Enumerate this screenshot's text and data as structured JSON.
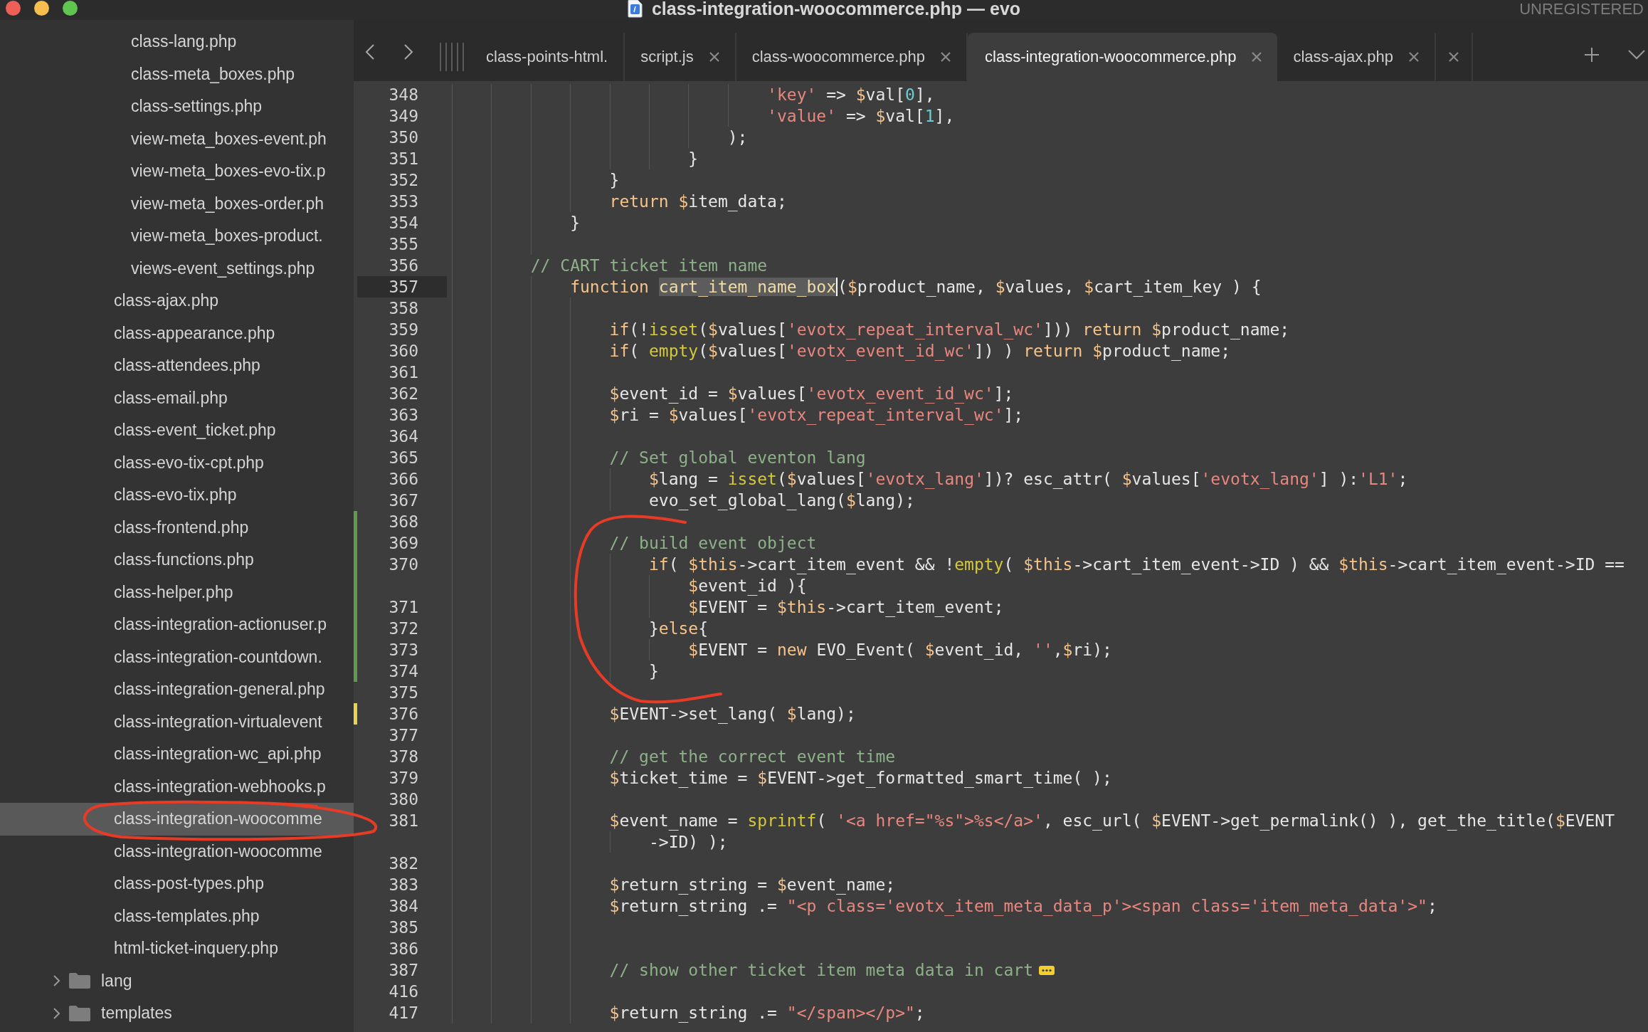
{
  "window": {
    "title": "class-integration-woocommerce.php — evo",
    "status": "UNREGISTERED"
  },
  "sidebar": {
    "items": [
      {
        "kind": "group",
        "children": [
          {
            "kind": "file",
            "label": "class-lang.php",
            "selected": false
          },
          {
            "kind": "file",
            "label": "class-meta_boxes.php",
            "selected": false
          },
          {
            "kind": "file",
            "label": "class-settings.php",
            "selected": false
          },
          {
            "kind": "file",
            "label": "view-meta_boxes-event.ph",
            "selected": false
          },
          {
            "kind": "file",
            "label": "view-meta_boxes-evo-tix.p",
            "selected": false
          },
          {
            "kind": "file",
            "label": "view-meta_boxes-order.ph",
            "selected": false
          },
          {
            "kind": "file",
            "label": "view-meta_boxes-product.",
            "selected": false
          },
          {
            "kind": "file",
            "label": "views-event_settings.php",
            "selected": false
          }
        ]
      },
      {
        "kind": "file",
        "label": "class-ajax.php",
        "selected": false
      },
      {
        "kind": "file",
        "label": "class-appearance.php",
        "selected": false
      },
      {
        "kind": "file",
        "label": "class-attendees.php",
        "selected": false
      },
      {
        "kind": "file",
        "label": "class-email.php",
        "selected": false
      },
      {
        "kind": "file",
        "label": "class-event_ticket.php",
        "selected": false
      },
      {
        "kind": "file",
        "label": "class-evo-tix-cpt.php",
        "selected": false
      },
      {
        "kind": "file",
        "label": "class-evo-tix.php",
        "selected": false
      },
      {
        "kind": "file",
        "label": "class-frontend.php",
        "selected": false
      },
      {
        "kind": "file",
        "label": "class-functions.php",
        "selected": false
      },
      {
        "kind": "file",
        "label": "class-helper.php",
        "selected": false
      },
      {
        "kind": "file",
        "label": "class-integration-actionuser.p",
        "selected": false
      },
      {
        "kind": "file",
        "label": "class-integration-countdown.",
        "selected": false
      },
      {
        "kind": "file",
        "label": "class-integration-general.php",
        "selected": false
      },
      {
        "kind": "file",
        "label": "class-integration-virtualevent",
        "selected": false
      },
      {
        "kind": "file",
        "label": "class-integration-wc_api.php",
        "selected": false
      },
      {
        "kind": "file",
        "label": "class-integration-webhooks.p",
        "selected": false
      },
      {
        "kind": "file",
        "label": "class-integration-woocomme",
        "selected": true
      },
      {
        "kind": "file",
        "label": "class-integration-woocomme",
        "selected": false
      },
      {
        "kind": "file",
        "label": "class-post-types.php",
        "selected": false
      },
      {
        "kind": "file",
        "label": "class-templates.php",
        "selected": false
      },
      {
        "kind": "file",
        "label": "html-ticket-inquery.php",
        "selected": false
      },
      {
        "kind": "folder",
        "label": "lang",
        "expanded": false
      },
      {
        "kind": "folder",
        "label": "templates",
        "expanded": false
      }
    ]
  },
  "tabs": [
    {
      "label": "class-points-html.",
      "selected": false,
      "closable": false
    },
    {
      "label": "script.js",
      "selected": false,
      "closable": true
    },
    {
      "label": "class-woocommerce.php",
      "selected": false,
      "closable": true
    },
    {
      "label": "class-integration-woocommerce.php",
      "selected": true,
      "closable": true
    },
    {
      "label": "class-ajax.php",
      "selected": false,
      "closable": true
    },
    {
      "selected": false,
      "closable": true
    }
  ],
  "editor": {
    "lines": [
      {
        "children": [
          {
            "children": [
              {
                "children": [
                  {
                    "children": [
                      {
                        "children": [
                          {
                            "children": [
                              {
                                "children": [
                                  {
                                    "children": [
                                      {
                                        "no": "348",
                                        "current": false,
                                        "segs": [
                                          {
                                            "kind": "string",
                                            "text": "'key'"
                                          },
                                          {
                                            "kind": "plain",
                                            "text": " => "
                                          },
                                          {
                                            "kind": "var",
                                            "text": "$val"
                                          },
                                          {
                                            "kind": "plain",
                                            "text": "["
                                          },
                                          {
                                            "kind": "number",
                                            "text": "0"
                                          },
                                          {
                                            "kind": "plain",
                                            "text": "],"
                                          }
                                        ]
                                      },
                                      {
                                        "no": "349",
                                        "current": false,
                                        "segs": [
                                          {
                                            "kind": "string",
                                            "text": "'value'"
                                          },
                                          {
                                            "kind": "plain",
                                            "text": " => "
                                          },
                                          {
                                            "kind": "var",
                                            "text": "$val"
                                          },
                                          {
                                            "kind": "plain",
                                            "text": "["
                                          },
                                          {
                                            "kind": "number",
                                            "text": "1"
                                          },
                                          {
                                            "kind": "plain",
                                            "text": "],"
                                          }
                                        ]
                                      }
                                    ]
                                  },
                                  {
                                    "no": "350",
                                    "current": false,
                                    "segs": [
                                      {
                                        "kind": "plain",
                                        "text": ");"
                                      }
                                    ]
                                  }
                                ]
                              },
                              {
                                "no": "351",
                                "current": false,
                                "segs": [
                                  {
                                    "kind": "plain",
                                    "text": "}"
                                  }
                                ]
                              }
                            ]
                          }
                        ]
                      },
                      {
                        "no": "352",
                        "current": false,
                        "segs": [
                          {
                            "kind": "plain",
                            "text": "}"
                          }
                        ]
                      },
                      {
                        "no": "353",
                        "current": false,
                        "segs": [
                          {
                            "kind": "keyword",
                            "text": "return "
                          },
                          {
                            "kind": "var",
                            "text": "$item_data"
                          },
                          {
                            "kind": "plain",
                            "text": ";"
                          }
                        ]
                      }
                    ]
                  },
                  {
                    "no": "354",
                    "current": false,
                    "segs": [
                      {
                        "kind": "plain",
                        "text": "}"
                      }
                    ]
                  },
                  {
                    "no": "355",
                    "current": false
                  }
                ]
              },
              {
                "no": "356",
                "current": false,
                "segs": [
                  {
                    "kind": "comment",
                    "text": "// CART ticket item name"
                  }
                ],
                "children": [
                  {
                    "no": "357",
                    "current": true,
                    "segs": [
                      {
                        "kind": "keyword",
                        "text": "function "
                      },
                      {
                        "kind": "match",
                        "text": "cart_item_name_box"
                      },
                      {
                        "kind": "plain",
                        "text": "("
                      },
                      {
                        "kind": "var",
                        "text": "$product_name"
                      },
                      {
                        "kind": "plain",
                        "text": ", "
                      },
                      {
                        "kind": "var",
                        "text": "$values"
                      },
                      {
                        "kind": "plain",
                        "text": ", "
                      },
                      {
                        "kind": "var",
                        "text": "$cart_item_key"
                      },
                      {
                        "kind": "plain",
                        "text": " ) {"
                      }
                    ],
                    "children": [
                      {
                        "no": "358",
                        "current": false
                      },
                      {
                        "no": "359",
                        "current": false,
                        "segs": [
                          {
                            "kind": "keyword",
                            "text": "if"
                          },
                          {
                            "kind": "plain",
                            "text": "(!"
                          },
                          {
                            "kind": "func",
                            "text": "isset"
                          },
                          {
                            "kind": "plain",
                            "text": "("
                          },
                          {
                            "kind": "var",
                            "text": "$values"
                          },
                          {
                            "kind": "plain",
                            "text": "["
                          },
                          {
                            "kind": "string",
                            "text": "'evotx_repeat_interval_wc'"
                          },
                          {
                            "kind": "plain",
                            "text": "])) "
                          },
                          {
                            "kind": "keyword",
                            "text": "return "
                          },
                          {
                            "kind": "var",
                            "text": "$product_name"
                          },
                          {
                            "kind": "plain",
                            "text": ";"
                          }
                        ]
                      },
                      {
                        "no": "360",
                        "current": false,
                        "segs": [
                          {
                            "kind": "keyword",
                            "text": "if"
                          },
                          {
                            "kind": "plain",
                            "text": "( "
                          },
                          {
                            "kind": "func",
                            "text": "empty"
                          },
                          {
                            "kind": "plain",
                            "text": "("
                          },
                          {
                            "kind": "var",
                            "text": "$values"
                          },
                          {
                            "kind": "plain",
                            "text": "["
                          },
                          {
                            "kind": "string",
                            "text": "'evotx_event_id_wc'"
                          },
                          {
                            "kind": "plain",
                            "text": "]) ) "
                          },
                          {
                            "kind": "keyword",
                            "text": "return "
                          },
                          {
                            "kind": "var",
                            "text": "$product_name"
                          },
                          {
                            "kind": "plain",
                            "text": ";"
                          }
                        ]
                      },
                      {
                        "no": "361",
                        "current": false
                      },
                      {
                        "no": "362",
                        "current": false,
                        "segs": [
                          {
                            "kind": "var",
                            "text": "$event_id"
                          },
                          {
                            "kind": "plain",
                            "text": " = "
                          },
                          {
                            "kind": "var",
                            "text": "$values"
                          },
                          {
                            "kind": "plain",
                            "text": "["
                          },
                          {
                            "kind": "string",
                            "text": "'evotx_event_id_wc'"
                          },
                          {
                            "kind": "plain",
                            "text": "];"
                          }
                        ]
                      },
                      {
                        "no": "363",
                        "current": false,
                        "segs": [
                          {
                            "kind": "var",
                            "text": "$ri"
                          },
                          {
                            "kind": "plain",
                            "text": " = "
                          },
                          {
                            "kind": "var",
                            "text": "$values"
                          },
                          {
                            "kind": "plain",
                            "text": "["
                          },
                          {
                            "kind": "string",
                            "text": "'evotx_repeat_interval_wc'"
                          },
                          {
                            "kind": "plain",
                            "text": "];"
                          }
                        ]
                      },
                      {
                        "no": "364",
                        "current": false
                      },
                      {
                        "no": "365",
                        "current": false,
                        "segs": [
                          {
                            "kind": "comment",
                            "text": "// Set global eventon lang"
                          }
                        ],
                        "children": [
                          {
                            "no": "366",
                            "current": false,
                            "segs": [
                              {
                                "kind": "var",
                                "text": "$lang"
                              },
                              {
                                "kind": "plain",
                                "text": " = "
                              },
                              {
                                "kind": "func",
                                "text": "isset"
                              },
                              {
                                "kind": "plain",
                                "text": "("
                              },
                              {
                                "kind": "var",
                                "text": "$values"
                              },
                              {
                                "kind": "plain",
                                "text": "["
                              },
                              {
                                "kind": "string",
                                "text": "'evotx_lang'"
                              },
                              {
                                "kind": "plain",
                                "text": "])? esc_attr( "
                              },
                              {
                                "kind": "var",
                                "text": "$values"
                              },
                              {
                                "kind": "plain",
                                "text": "["
                              },
                              {
                                "kind": "string",
                                "text": "'evotx_lang'"
                              },
                              {
                                "kind": "plain",
                                "text": "] ):"
                              },
                              {
                                "kind": "string",
                                "text": "'L1'"
                              },
                              {
                                "kind": "plain",
                                "text": ";"
                              }
                            ]
                          },
                          {
                            "no": "367",
                            "current": false,
                            "segs": [
                              {
                                "kind": "plain",
                                "text": "evo_set_global_lang("
                              },
                              {
                                "kind": "var",
                                "text": "$lang"
                              },
                              {
                                "kind": "plain",
                                "text": ");"
                              }
                            ]
                          }
                        ]
                      },
                      {
                        "no": "368",
                        "current": false,
                        "added": true
                      },
                      {
                        "no": "369",
                        "current": false,
                        "added": true,
                        "segs": [
                          {
                            "kind": "comment",
                            "text": "// build event object"
                          }
                        ],
                        "children": [
                          {
                            "no": "370",
                            "current": false,
                            "added": true,
                            "segs": [
                              {
                                "kind": "keyword",
                                "text": "if"
                              },
                              {
                                "kind": "plain",
                                "text": "( "
                              },
                              {
                                "kind": "keyword",
                                "text": "$this"
                              },
                              {
                                "kind": "plain",
                                "text": "->cart_item_event && !"
                              },
                              {
                                "kind": "func",
                                "text": "empty"
                              },
                              {
                                "kind": "plain",
                                "text": "( "
                              },
                              {
                                "kind": "keyword",
                                "text": "$this"
                              },
                              {
                                "kind": "plain",
                                "text": "->cart_item_event->ID ) && "
                              },
                              {
                                "kind": "keyword",
                                "text": "$this"
                              },
                              {
                                "kind": "plain",
                                "text": "->cart_item_event->ID =="
                              }
                            ],
                            "wrap": [
                              {
                                "kind": "var",
                                "text": "$event_id"
                              },
                              {
                                "kind": "plain",
                                "text": " ){"
                              }
                            ],
                            "children": [
                              {
                                "no": "371",
                                "current": false,
                                "added": true,
                                "segs": [
                                  {
                                    "kind": "var",
                                    "text": "$EVENT"
                                  },
                                  {
                                    "kind": "plain",
                                    "text": " = "
                                  },
                                  {
                                    "kind": "keyword",
                                    "text": "$this"
                                  },
                                  {
                                    "kind": "plain",
                                    "text": "->cart_item_event;"
                                  }
                                ]
                              }
                            ]
                          },
                          {
                            "no": "372",
                            "current": false,
                            "added": true,
                            "segs": [
                              {
                                "kind": "plain",
                                "text": "}"
                              },
                              {
                                "kind": "keyword",
                                "text": "else"
                              },
                              {
                                "kind": "plain",
                                "text": "{"
                              }
                            ],
                            "children": [
                              {
                                "no": "373",
                                "current": false,
                                "added": true,
                                "segs": [
                                  {
                                    "kind": "var",
                                    "text": "$EVENT"
                                  },
                                  {
                                    "kind": "plain",
                                    "text": " = "
                                  },
                                  {
                                    "kind": "keyword",
                                    "text": "new"
                                  },
                                  {
                                    "kind": "plain",
                                    "text": " EVO_Event( "
                                  },
                                  {
                                    "kind": "var",
                                    "text": "$event_id"
                                  },
                                  {
                                    "kind": "plain",
                                    "text": ", "
                                  },
                                  {
                                    "kind": "string",
                                    "text": "''"
                                  },
                                  {
                                    "kind": "plain",
                                    "text": ","
                                  },
                                  {
                                    "kind": "var",
                                    "text": "$ri"
                                  },
                                  {
                                    "kind": "plain",
                                    "text": ");"
                                  }
                                ]
                              }
                            ]
                          },
                          {
                            "no": "374",
                            "current": false,
                            "added": true,
                            "segs": [
                              {
                                "kind": "plain",
                                "text": "}"
                              }
                            ]
                          }
                        ]
                      },
                      {
                        "no": "375",
                        "current": false
                      },
                      {
                        "no": "376",
                        "current": false,
                        "modified": true,
                        "segs": [
                          {
                            "kind": "var",
                            "text": "$EVENT"
                          },
                          {
                            "kind": "plain",
                            "text": "->set_lang( "
                          },
                          {
                            "kind": "var",
                            "text": "$lang"
                          },
                          {
                            "kind": "plain",
                            "text": ");"
                          }
                        ]
                      },
                      {
                        "no": "377",
                        "current": false
                      },
                      {
                        "no": "378",
                        "current": false,
                        "segs": [
                          {
                            "kind": "comment",
                            "text": "// get the correct event time"
                          }
                        ]
                      },
                      {
                        "no": "379",
                        "current": false,
                        "segs": [
                          {
                            "kind": "var",
                            "text": "$ticket_time"
                          },
                          {
                            "kind": "plain",
                            "text": " = "
                          },
                          {
                            "kind": "var",
                            "text": "$EVENT"
                          },
                          {
                            "kind": "plain",
                            "text": "->get_formatted_smart_time( );"
                          }
                        ]
                      },
                      {
                        "no": "380",
                        "current": false
                      },
                      {
                        "no": "381",
                        "current": false,
                        "segs": [
                          {
                            "kind": "var",
                            "text": "$event_name"
                          },
                          {
                            "kind": "plain",
                            "text": " = "
                          },
                          {
                            "kind": "func",
                            "text": "sprintf"
                          },
                          {
                            "kind": "plain",
                            "text": "( "
                          },
                          {
                            "kind": "string",
                            "text": "'<a href=\"%s\">%s</a>'"
                          },
                          {
                            "kind": "plain",
                            "text": ", esc_url( "
                          },
                          {
                            "kind": "var",
                            "text": "$EVENT"
                          },
                          {
                            "kind": "plain",
                            "text": "->get_permalink() ), get_the_title("
                          },
                          {
                            "kind": "var",
                            "text": "$EVENT"
                          }
                        ],
                        "wrap": [
                          {
                            "kind": "plain",
                            "text": "->ID) );"
                          }
                        ]
                      },
                      {
                        "no": "382",
                        "current": false
                      },
                      {
                        "no": "383",
                        "current": false,
                        "segs": [
                          {
                            "kind": "var",
                            "text": "$return_string"
                          },
                          {
                            "kind": "plain",
                            "text": " = "
                          },
                          {
                            "kind": "var",
                            "text": "$event_name"
                          },
                          {
                            "kind": "plain",
                            "text": ";"
                          }
                        ]
                      },
                      {
                        "no": "384",
                        "current": false,
                        "segs": [
                          {
                            "kind": "var",
                            "text": "$return_string"
                          },
                          {
                            "kind": "plain",
                            "text": " .= "
                          },
                          {
                            "kind": "string",
                            "text": "\"<p class='evotx_item_meta_data_p'><span class='item_meta_data'>\""
                          },
                          {
                            "kind": "plain",
                            "text": ";"
                          }
                        ]
                      },
                      {
                        "no": "385",
                        "current": false
                      },
                      {
                        "no": "386",
                        "current": false
                      },
                      {
                        "no": "387",
                        "current": false,
                        "folded": true,
                        "segs": [
                          {
                            "kind": "comment",
                            "text": "// show other ticket item meta data in cart"
                          }
                        ]
                      },
                      {
                        "no": "416",
                        "current": false
                      },
                      {
                        "no": "417",
                        "current": false,
                        "segs": [
                          {
                            "kind": "var",
                            "text": "$return_string"
                          },
                          {
                            "kind": "plain",
                            "text": " .= "
                          },
                          {
                            "kind": "string",
                            "text": "\"</span></p>\""
                          },
                          {
                            "kind": "plain",
                            "text": ";"
                          }
                        ]
                      }
                    ]
                  }
                ]
              }
            ]
          }
        ]
      }
    ]
  }
}
